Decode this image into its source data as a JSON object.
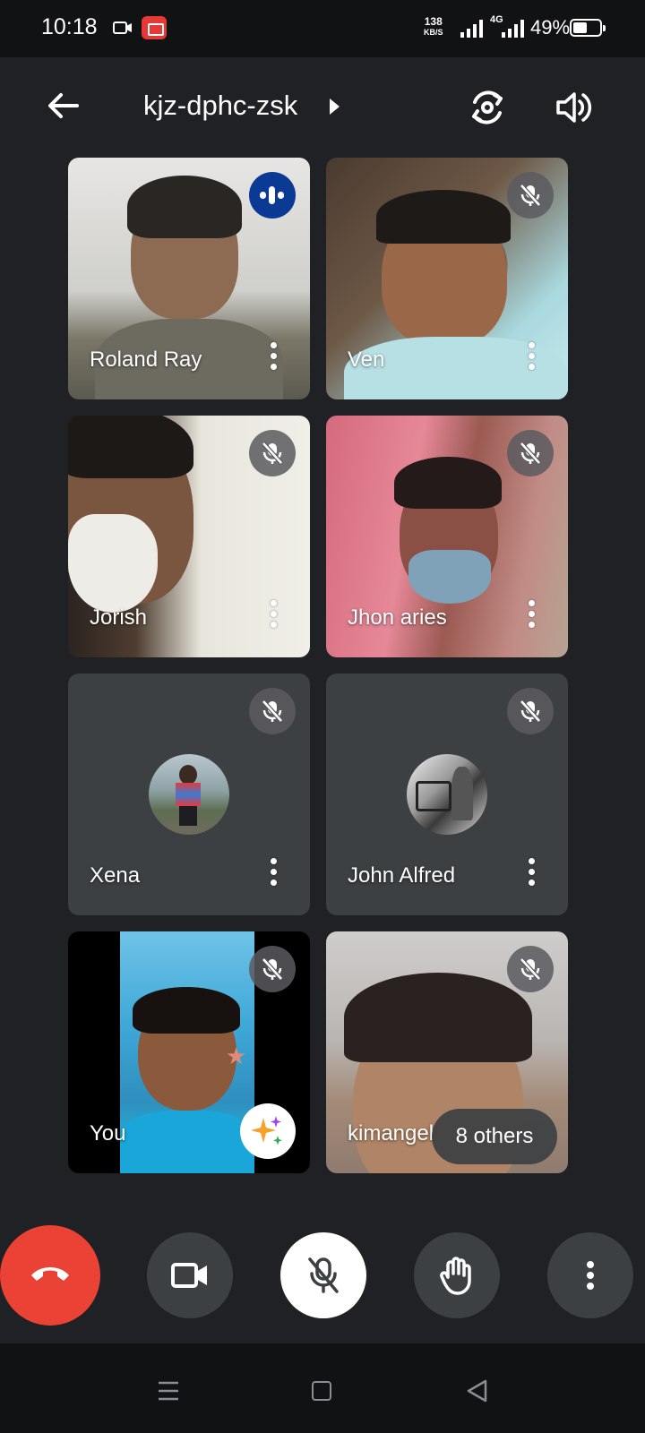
{
  "status_bar": {
    "time": "10:18",
    "speed_value": "138",
    "speed_unit": "KB/S",
    "network": "4G",
    "battery": "49%"
  },
  "header": {
    "meeting_code": "kjz-dphc-zsk",
    "back_icon": "arrow-left-icon",
    "switch_camera_icon": "switch-camera-icon",
    "audio_icon": "speaker-icon"
  },
  "participants": [
    {
      "name": "Roland Ray",
      "status": "speaking"
    },
    {
      "name": "Ven",
      "status": "muted"
    },
    {
      "name": "Jorish",
      "status": "muted"
    },
    {
      "name": "Jhon aries",
      "status": "muted"
    },
    {
      "name": "Xena",
      "status": "muted",
      "camera": "off"
    },
    {
      "name": "John Alfred",
      "status": "muted",
      "camera": "off"
    },
    {
      "name": "You",
      "status": "muted"
    },
    {
      "name": "kimangel",
      "status": "muted"
    }
  ],
  "others_pill": "8 others",
  "controls": {
    "end_call_color": "#ea4335",
    "items": [
      "end-call-icon",
      "video-camera-icon",
      "mic-off-icon",
      "raise-hand-icon",
      "more-vert-icon"
    ]
  },
  "colors": {
    "background": "#202124",
    "tile": "#3c4043",
    "speaking_badge": "#0b3a94"
  }
}
